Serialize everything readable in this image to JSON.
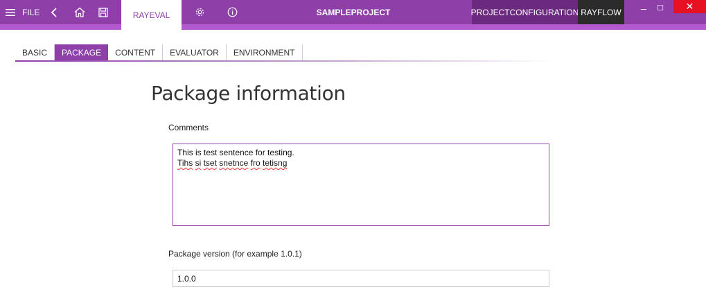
{
  "titlebar": {
    "file_label": "FILE",
    "active_tab": "RAYEVAL",
    "project_name": "SAMPLEPROJECT",
    "project_configuration": "PROJECTCONFIGURATION",
    "rayflow": "RAYFLOW",
    "minimize_glyph": "–",
    "maximize_glyph": "☐",
    "close_glyph": "✕",
    "icons": [
      "hamburger-icon",
      "back-arrow-icon",
      "home-icon",
      "save-icon",
      "gear-icon",
      "info-icon"
    ]
  },
  "subtabs": [
    {
      "label": "BASIC",
      "active": false
    },
    {
      "label": "PACKAGE",
      "active": true
    },
    {
      "label": "CONTENT",
      "active": false
    },
    {
      "label": "EVALUATOR",
      "active": false
    },
    {
      "label": "ENVIRONMENT",
      "active": false
    }
  ],
  "content": {
    "title": "Package information",
    "comments_label": "Comments",
    "comments_lines": [
      [
        {
          "text": "This is test sentence for testing.",
          "misspelled": false
        }
      ],
      [
        {
          "text": "Tihs",
          "misspelled": true
        },
        {
          "text": " ",
          "misspelled": false
        },
        {
          "text": "si",
          "misspelled": true
        },
        {
          "text": " ",
          "misspelled": false
        },
        {
          "text": "tset",
          "misspelled": true
        },
        {
          "text": " ",
          "misspelled": false
        },
        {
          "text": "snetnce",
          "misspelled": true
        },
        {
          "text": " ",
          "misspelled": false
        },
        {
          "text": "fro",
          "misspelled": true
        },
        {
          "text": " ",
          "misspelled": false
        },
        {
          "text": "tetisng",
          "misspelled": true
        }
      ]
    ],
    "version_label": "Package version (for example 1.0.1)",
    "version_value": "1.0.0"
  },
  "colors": {
    "titlebar": "#8e3fa8",
    "accent_strip": "#b35ad1",
    "projconf_bg": "#6b2a80",
    "rayflow_bg": "#2b2b2b",
    "close_bg": "#e81123"
  }
}
